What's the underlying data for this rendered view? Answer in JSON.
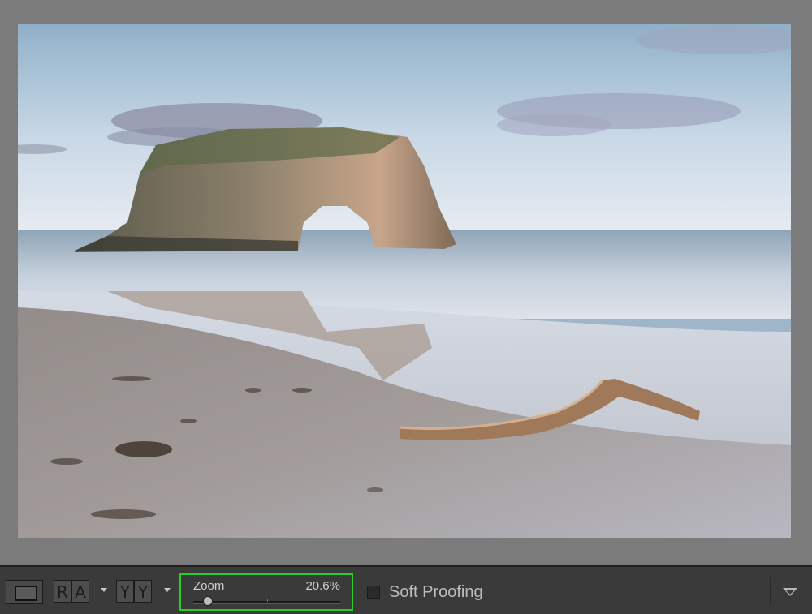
{
  "toolbar": {
    "loupe_view_icon": "rectangle-icon",
    "before_after_left_right": [
      "R",
      "A"
    ],
    "before_after_top_bottom": [
      "Y",
      "Y"
    ],
    "zoom": {
      "label": "Zoom",
      "value": "20.6%",
      "slider_fraction": 0.1
    },
    "soft_proofing": {
      "label": "Soft Proofing",
      "checked": false
    },
    "toolbar_menu_icon": "triangle-down-icon"
  },
  "colors": {
    "zoom_highlight": "#29d024",
    "toolbar_bg": "#3a3a3a",
    "canvas_bg": "#7b7b7b"
  }
}
